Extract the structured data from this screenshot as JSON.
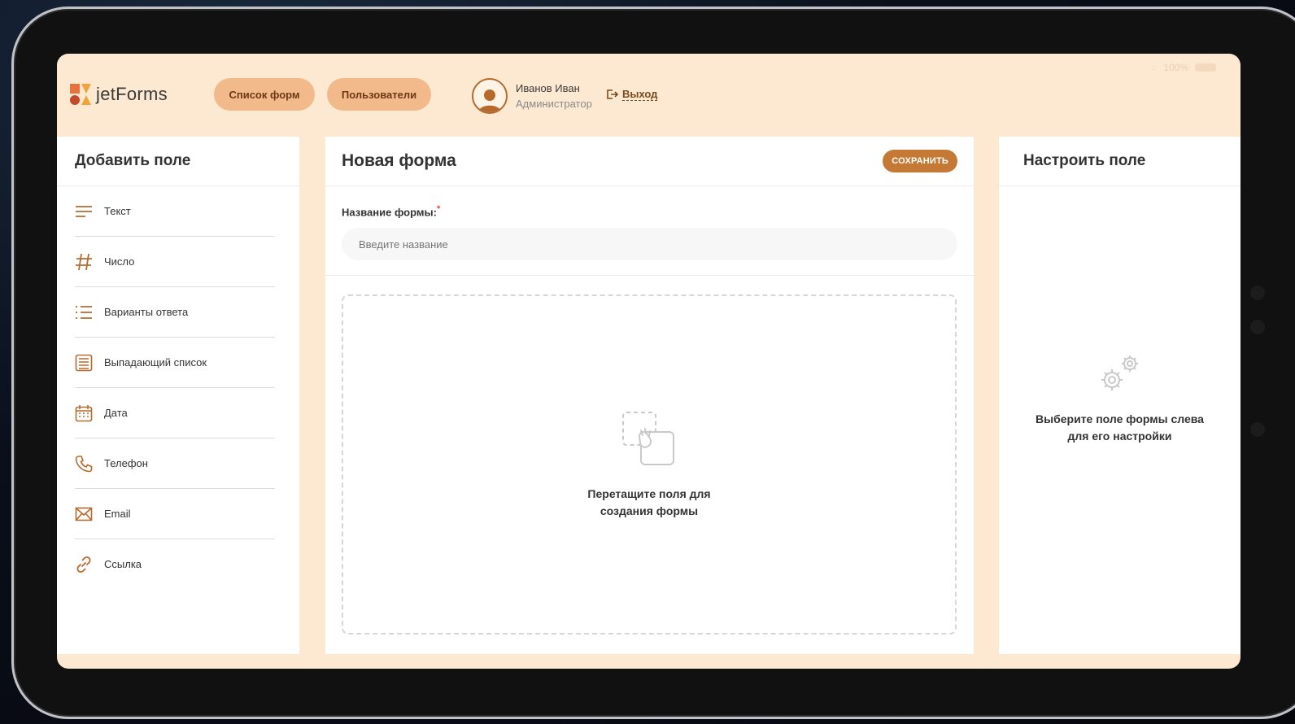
{
  "app": {
    "name": "jetForms",
    "status": {
      "battery": "100%"
    }
  },
  "header": {
    "nav": [
      {
        "label": "Список форм"
      },
      {
        "label": "Пользователи"
      }
    ],
    "user": {
      "name": "Иванов Иван",
      "role": "Администратор"
    },
    "logout_label": "Выход"
  },
  "left_panel": {
    "title": "Добавить поле",
    "items": [
      {
        "label": "Текст",
        "icon": "text-lines-icon"
      },
      {
        "label": "Число",
        "icon": "hash-icon"
      },
      {
        "label": "Варианты ответа",
        "icon": "list-icon"
      },
      {
        "label": "Выпадающий список",
        "icon": "dropdown-list-icon"
      },
      {
        "label": "Дата",
        "icon": "calendar-icon"
      },
      {
        "label": "Телефон",
        "icon": "phone-icon"
      },
      {
        "label": "Email",
        "icon": "envelope-icon"
      },
      {
        "label": "Ссылка",
        "icon": "link-icon"
      }
    ]
  },
  "center_panel": {
    "title": "Новая форма",
    "save_label": "СОХРАНИТЬ",
    "form_name": {
      "label": "Название формы:",
      "required_mark": "*",
      "placeholder": "Введите название",
      "value": ""
    },
    "dropzone_text": "Перетащите поля для создания формы"
  },
  "right_panel": {
    "title": "Настроить поле",
    "empty_text": "Выберите поле формы слева для его настройки"
  },
  "colors": {
    "accent": "#c47a34",
    "pill_bg": "#f2b98a",
    "screen_bg": "#fde9d2"
  }
}
